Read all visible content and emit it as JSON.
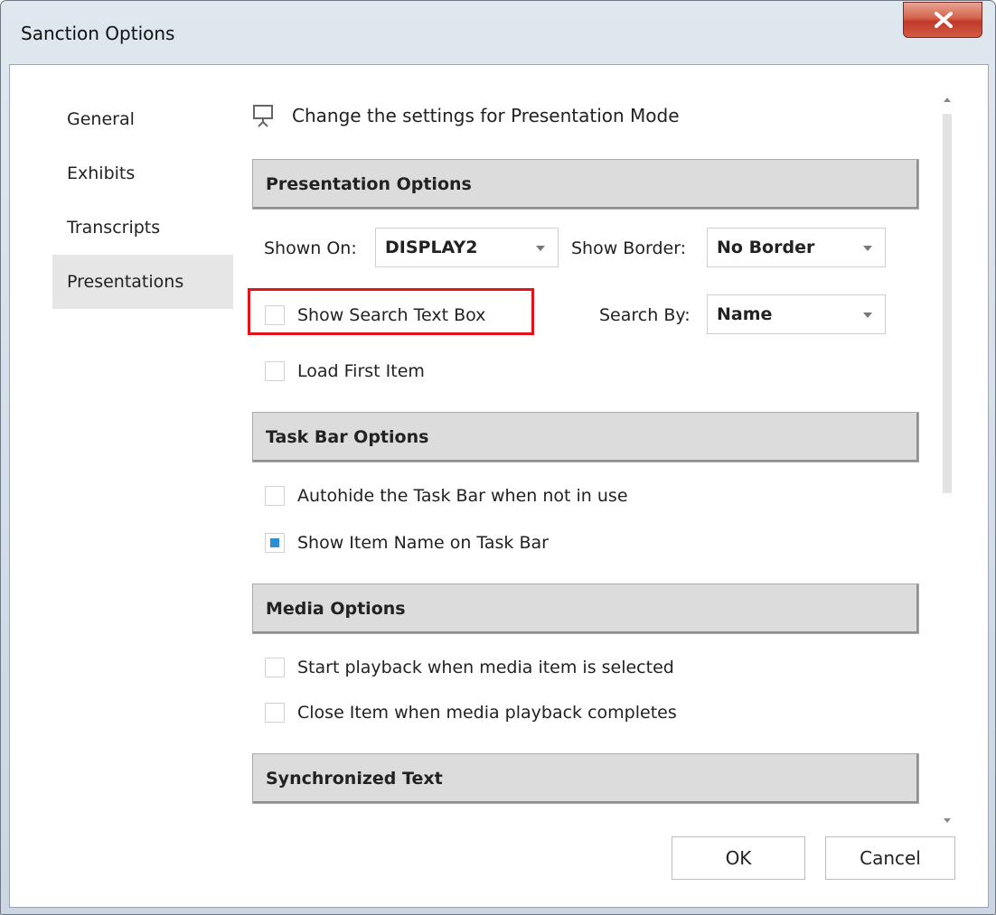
{
  "window": {
    "title": "Sanction Options"
  },
  "sidebar": {
    "items": [
      {
        "label": "General"
      },
      {
        "label": "Exhibits"
      },
      {
        "label": "Transcripts"
      },
      {
        "label": "Presentations",
        "active": true
      }
    ]
  },
  "header": {
    "text": "Change the settings for Presentation Mode",
    "icon": "presentation-icon"
  },
  "presentation_options": {
    "title": "Presentation Options",
    "shown_on_label": "Shown On:",
    "shown_on_value": "DISPLAY2",
    "show_border_label": "Show Border:",
    "show_border_value": "No Border",
    "show_search_label": "Show Search Text Box",
    "show_search_checked": false,
    "search_by_label": "Search By:",
    "search_by_value": "Name",
    "load_first_label": "Load First Item",
    "load_first_checked": false
  },
  "task_bar_options": {
    "title": "Task Bar Options",
    "autohide_label": "Autohide the Task Bar when not in use",
    "autohide_checked": false,
    "show_item_name_label": "Show Item Name on Task Bar",
    "show_item_name_checked": true
  },
  "media_options": {
    "title": "Media Options",
    "start_playback_label": "Start playback when media item is selected",
    "start_playback_checked": false,
    "close_item_label": "Close Item when media playback completes",
    "close_item_checked": false
  },
  "synchronized_text": {
    "title": "Synchronized Text"
  },
  "footer": {
    "ok_label": "OK",
    "cancel_label": "Cancel"
  },
  "colors": {
    "highlight": "#e2141b",
    "checkbox_checked": "#2b8fd6",
    "close_button": "#c0392b"
  }
}
